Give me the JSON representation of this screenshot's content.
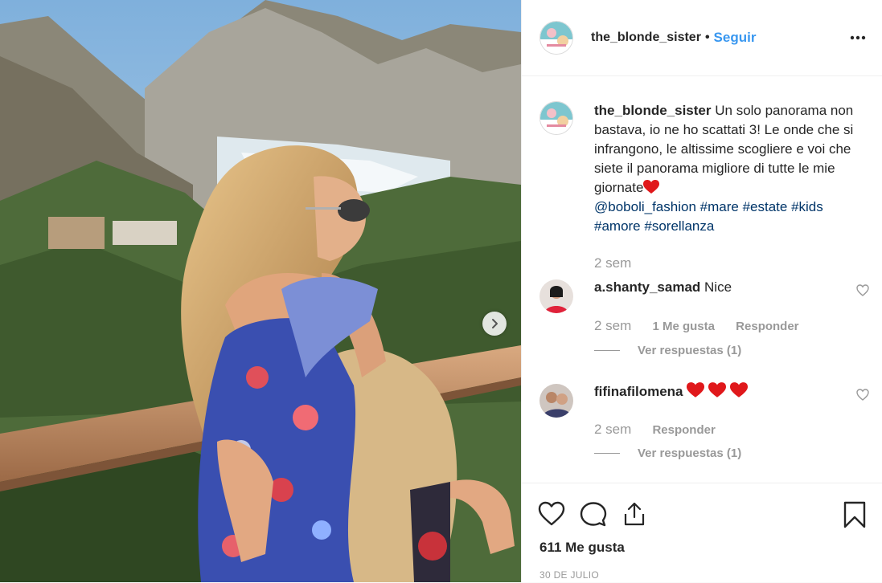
{
  "post": {
    "username": "the_blonde_sister",
    "dot": "•",
    "follow_label": "Seguir",
    "caption": {
      "username": "the_blonde_sister",
      "text": "Un solo panorama non bastava, io ne ho scattati 3! Le onde che si infrangono, le altissime scogliere e voi che siete il panorama migliore di tutte le mie giornate",
      "mention": "@boboli_fashion",
      "hashtags": [
        "#mare",
        "#estate",
        "#kids",
        "#amore",
        "#sorellanza"
      ],
      "time": "2 sem"
    },
    "comments": [
      {
        "username": "a.shanty_samad",
        "text": "Nice",
        "time": "2 sem",
        "likes": "1 Me gusta",
        "reply_label": "Responder",
        "view_replies": "Ver respuestas (1)"
      },
      {
        "username": "fifinafilomena",
        "text": "",
        "time": "2 sem",
        "reply_label": "Responder",
        "view_replies": "Ver respuestas (1)"
      }
    ],
    "likes_count": "611 Me gusta",
    "date": "30 DE JULIO"
  },
  "icons": [
    "more-options-icon",
    "next-arrow-icon",
    "heart-icon",
    "comment-icon",
    "share-icon",
    "bookmark-icon",
    "red-heart-emoji"
  ],
  "colors": {
    "link": "#003569",
    "follow": "#3897f0",
    "muted": "#999999",
    "heart_emoji": "#e0181b"
  }
}
